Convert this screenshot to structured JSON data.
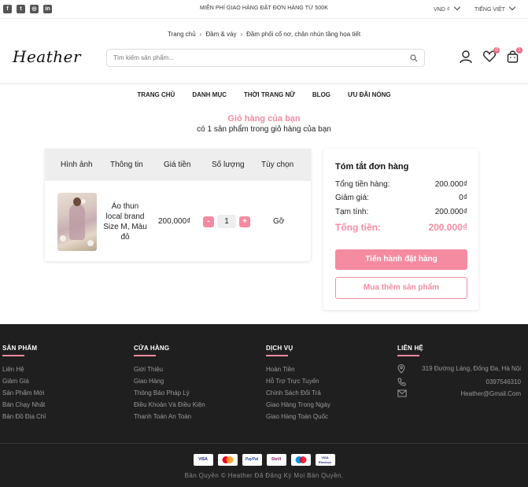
{
  "topbar": {
    "socials": [
      {
        "name": "facebook-icon",
        "glyph": "f"
      },
      {
        "name": "twitter-icon",
        "glyph": "t"
      },
      {
        "name": "instagram-icon",
        "glyph": "◎"
      },
      {
        "name": "linkedin-icon",
        "glyph": "in"
      }
    ],
    "promo": "MIỄN PHÍ GIAO HÀNG ĐẶT ĐƠN HÀNG TỪ 500K",
    "currency": "VND ₫",
    "language": "TIẾNG VIỆT"
  },
  "breadcrumb": [
    "Trang chủ",
    "Đầm & váy",
    "Đầm phối cổ nơ, chân nhún tầng họa tiết"
  ],
  "header": {
    "logo": "Heather",
    "search_placeholder": "Tìm kiếm sản phẩm...",
    "wishlist_count": "0",
    "cart_count": "1"
  },
  "nav": [
    "TRANG CHỦ",
    "DANH MỤC",
    "THỜI TRANG NỮ",
    "BLOG",
    "ƯU ĐÃI NÓNG"
  ],
  "cart": {
    "title": "Giỏ hàng của bạn",
    "subtitle": "có 1 sản phẩm trong giỏ hàng của bạn",
    "columns": [
      "Hình ảnh",
      "Thông tin",
      "Giá tiền",
      "Số lượng",
      "Tùy chọn"
    ],
    "item": {
      "name_lines": [
        "Áo thun",
        "local brand",
        "Size M, Màu",
        "đỏ"
      ],
      "price": "200,000₫",
      "quantity": "1",
      "minus": "-",
      "plus": "+",
      "remove": "Gỡ"
    }
  },
  "summary": {
    "title": "Tóm tắt đơn hàng",
    "rows": [
      {
        "label": "Tổng tiền hàng:",
        "value": "200.000₫"
      },
      {
        "label": "Giảm giá:",
        "value": "0₫"
      },
      {
        "label": "Tạm tính:",
        "value": "200.000₫"
      }
    ],
    "total_label": "Tổng tiền:",
    "total_value": "200.000₫",
    "checkout": "Tiến hành đặt hàng",
    "continue": "Mua thêm sản phẩm"
  },
  "footer": {
    "columns": [
      {
        "title": "SẢN PHẨM",
        "links": [
          "Liên Hệ",
          "Giảm Giá",
          "Sản Phẩm Mới",
          "Bán Chạy Nhất",
          "Bản Đồ Địa Chỉ"
        ]
      },
      {
        "title": "CỬA HÀNG",
        "links": [
          "Giới Thiệu",
          "Giao Hàng",
          "Thông Báo Pháp Lý",
          "Điều Khoản Và Điều Kiện",
          "Thanh Toán An Toàn"
        ]
      },
      {
        "title": "DỊCH VỤ",
        "links": [
          "Hoàn Tiền",
          "Hỗ Trợ Trực Tuyến",
          "Chính Sách Đổi Trả",
          "Giao Hàng Trong Ngày",
          "Giao Hàng Toàn Quốc"
        ]
      }
    ],
    "contact": {
      "title": "LIÊN HỆ",
      "address": "319 Đường Láng, Đống Đa, Hà Nội",
      "phone": "0397546310",
      "email": "Heather@Gmail.Com"
    },
    "payments": [
      "VISA",
      "",
      "PayPal",
      "Skrill",
      "",
      "VISA Electron"
    ],
    "copyright": "Bản Quyền © Heather Đã Đăng Ký Mọi Bản Quyền."
  },
  "colors": {
    "accent": "#f48ba0",
    "footer_bg": "#1f1f1f"
  }
}
